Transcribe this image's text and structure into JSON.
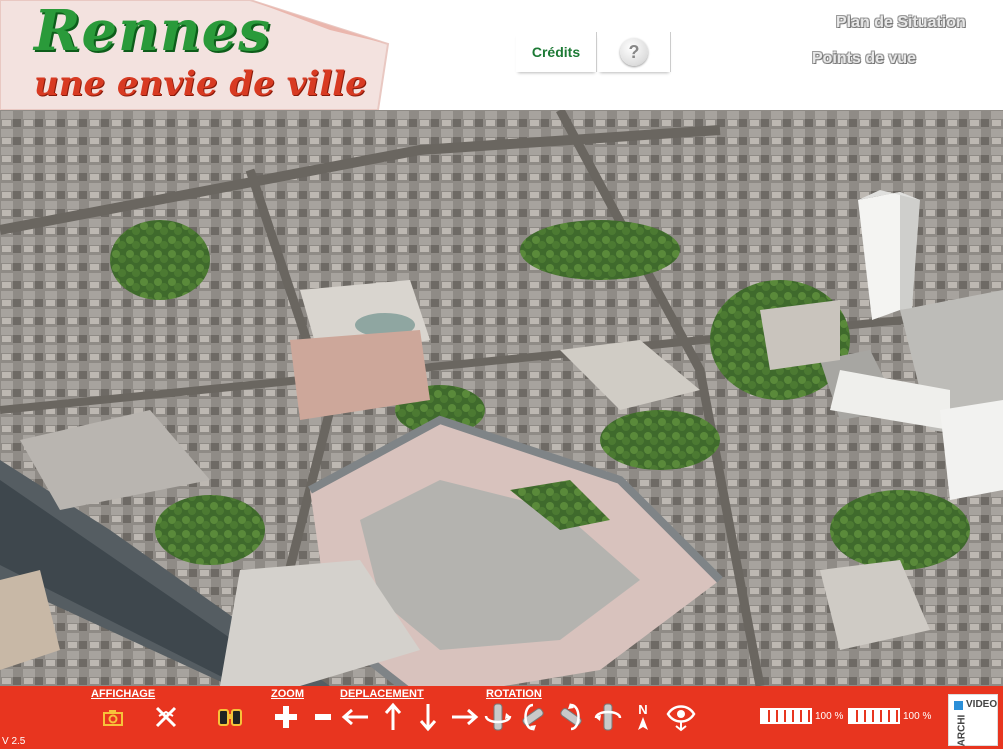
{
  "header": {
    "logo_line1": "Rennes",
    "logo_line2": "une envie de ville",
    "tabs": {
      "credits": "Crédits",
      "help": "?"
    },
    "nav": {
      "plan": "Plan de Situation",
      "points": "Points de vue"
    }
  },
  "toolbar": {
    "sections": {
      "affichage": "AFFICHAGE",
      "zoom": "ZOOM",
      "deplacement": "DEPLACEMENT",
      "rotation": "ROTATION"
    },
    "version": "V 2.5",
    "north_label": "N",
    "meters": [
      {
        "value": "100 %",
        "fraction": 1.0
      },
      {
        "value": "100 %",
        "fraction": 1.0
      }
    ],
    "branding": {
      "top": "VIDEO",
      "side": "ARCHI"
    }
  },
  "colors": {
    "toolbar": "#e8351f",
    "logo_green": "#2a9a3a",
    "logo_red": "#d83a22",
    "credits_green": "#1d7a35"
  },
  "icons": [
    "camera-icon",
    "layers-toggle-icon",
    "binoculars-icon",
    "zoom-in-icon",
    "zoom-out-icon",
    "arrow-left-icon",
    "arrow-up-icon",
    "arrow-down-icon",
    "arrow-right-icon",
    "rotate-left-icon",
    "tilt-up-icon",
    "tilt-down-icon",
    "rotate-right-icon",
    "north-icon",
    "eye-icon",
    "help-icon"
  ]
}
